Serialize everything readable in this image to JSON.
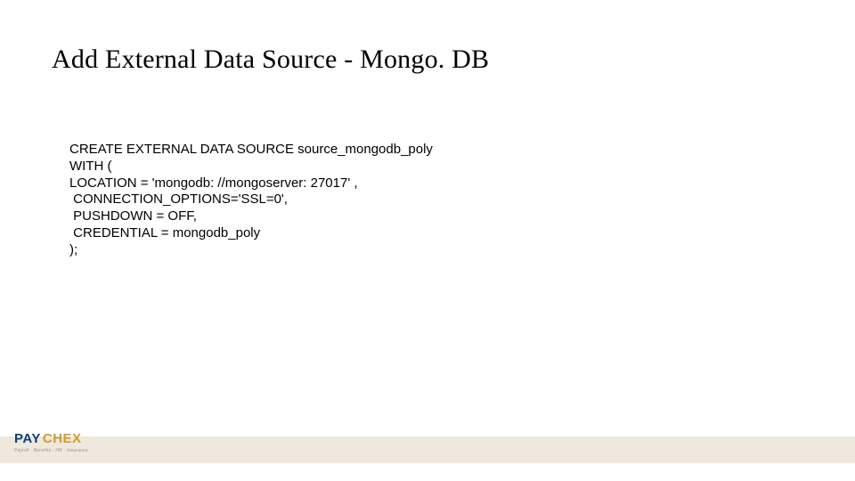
{
  "title": "Add External Data Source - Mongo. DB",
  "code": {
    "l1": "CREATE EXTERNAL DATA SOURCE source_mongodb_poly",
    "l2": "WITH (",
    "l3": "LOCATION = 'mongodb: //mongoserver: 27017' ,",
    "l4": " CONNECTION_OPTIONS='SSL=0',",
    "l5": " PUSHDOWN = OFF,",
    "l6": " CREDENTIAL = mongodb_poly",
    "l7": ");"
  },
  "logo": {
    "part1": "PAY",
    "part2": "CHEX",
    "tagline": "Payroll · Benefits · HR · Insurance"
  }
}
